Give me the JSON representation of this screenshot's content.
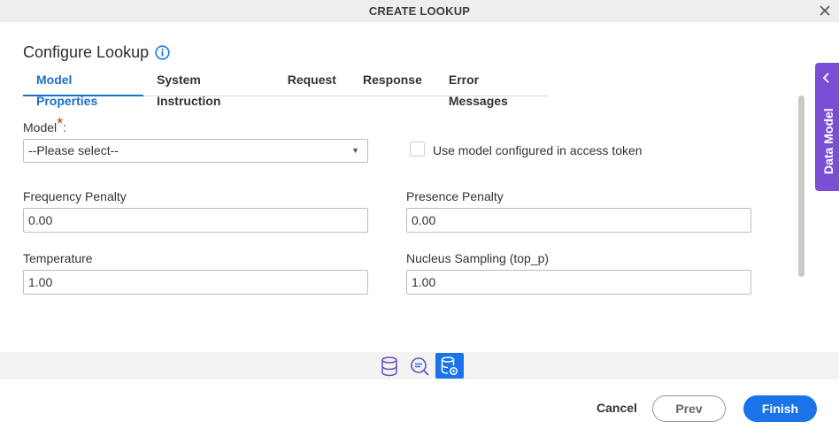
{
  "window": {
    "title": "CREATE LOOKUP"
  },
  "header": {
    "title": "Configure Lookup"
  },
  "tabs": [
    {
      "label": "Model Properties"
    },
    {
      "label": "System Instruction"
    },
    {
      "label": "Request"
    },
    {
      "label": "Response"
    },
    {
      "label": "Error Messages"
    }
  ],
  "form": {
    "model": {
      "label": "Model",
      "required_mark": "*",
      "suffix": ":",
      "value": "--Please select--"
    },
    "use_model_token": {
      "label": "Use model configured in access token",
      "checked": false
    },
    "frequency_penalty": {
      "label": "Frequency Penalty",
      "value": "0.00"
    },
    "presence_penalty": {
      "label": "Presence Penalty",
      "value": "0.00"
    },
    "temperature": {
      "label": "Temperature",
      "value": "1.00"
    },
    "nucleus_sampling": {
      "label": "Nucleus Sampling (top_p)",
      "value": "1.00"
    }
  },
  "side_panel": {
    "label": "Data Model"
  },
  "footer": {
    "cancel_label": "Cancel",
    "prev_label": "Prev",
    "finish_label": "Finish"
  },
  "colors": {
    "accent": "#1a73e8",
    "side_panel": "#7b4ed6",
    "required": "#c0392b"
  },
  "icons": [
    "close-icon",
    "info-icon",
    "chevron-left-icon",
    "database-icon",
    "search-icon",
    "database-settings-icon",
    "dropdown-arrow-icon"
  ]
}
